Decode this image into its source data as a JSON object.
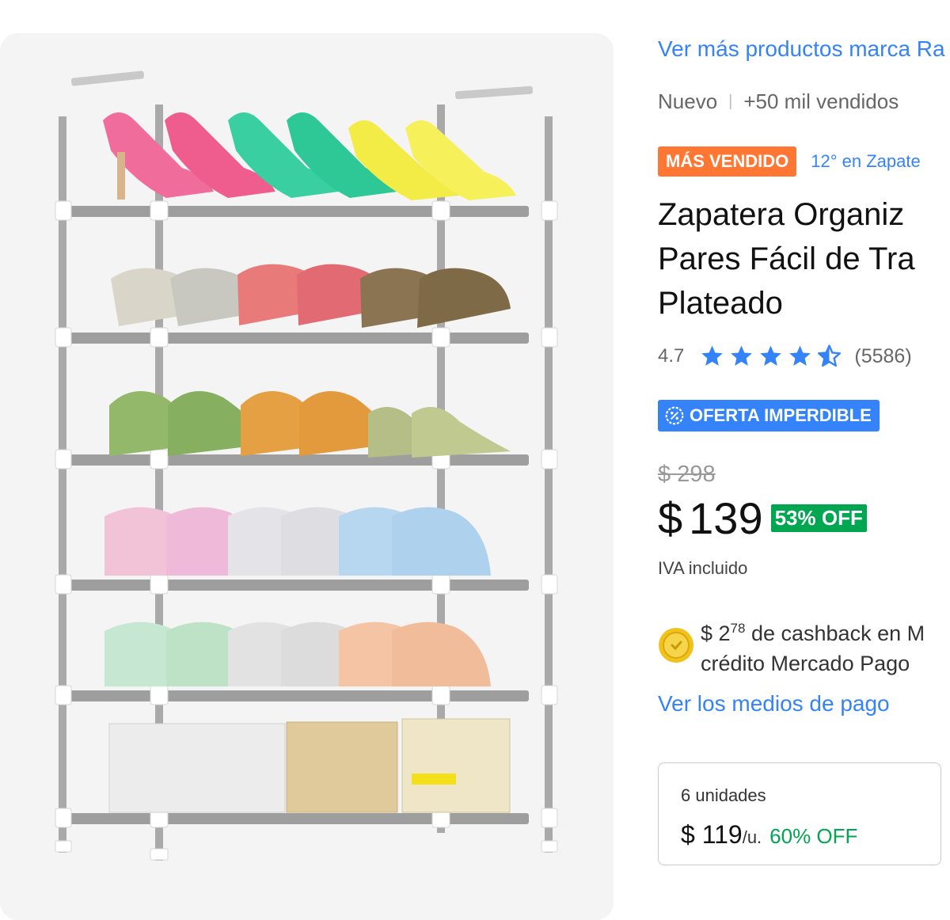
{
  "brand_link": "Ver más productos marca Ra",
  "meta": {
    "condition": "Nuevo",
    "sold": "+50 mil vendidos"
  },
  "badges": {
    "best_seller": "MÁS VENDIDO",
    "ranking": "12° en Zapate"
  },
  "title_lines": [
    "Zapatera Organiz",
    "Pares Fácil de Tra",
    "Plateado"
  ],
  "rating": {
    "score": "4.7",
    "stars": 4.7,
    "count": "(5586)"
  },
  "deal": "OFERTA IMPERDIBLE",
  "price": {
    "old_currency": "$",
    "old": "298",
    "currency": "$",
    "current": "139",
    "discount": "53% OFF",
    "tax_note": "IVA incluido"
  },
  "cashback": {
    "currency_int": "$ 2",
    "cents": "78",
    "line1_rest": " de cashback en M",
    "line2": "crédito Mercado Pago"
  },
  "payment_link": "Ver los medios de pago",
  "bulk": {
    "units": "6 unidades",
    "currency": "$",
    "price": "119",
    "per": "/u.",
    "discount": "60% OFF"
  },
  "colors": {
    "link": "#3483fa",
    "badge_orange": "#ff7733",
    "discount_green": "#00a650",
    "deal_blue": "#3483fa",
    "star": "#3483fa"
  },
  "icons": {
    "star": "star-icon",
    "deal": "deal-icon",
    "coin": "coin-icon"
  }
}
